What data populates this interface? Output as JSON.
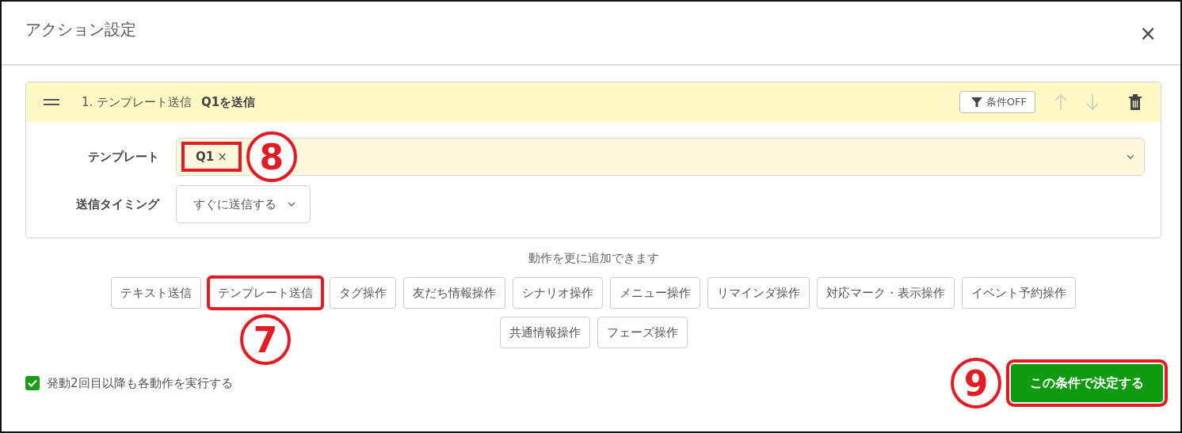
{
  "dialog": {
    "title": "アクション設定",
    "close": "×"
  },
  "action": {
    "number": "1.",
    "type": "テンプレート送信",
    "summary": "Q1を送信",
    "condition_button": "条件OFF",
    "move_up_disabled": true,
    "move_down_disabled": true,
    "fields": [
      {
        "kind": "tags",
        "label": "テンプレート",
        "tags": [
          {
            "text": "Q1",
            "remove": "×",
            "highlighted": true,
            "callout": "8"
          }
        ]
      },
      {
        "kind": "select",
        "label": "送信タイミング",
        "value": "すぐに送信する"
      }
    ]
  },
  "add_hint": "動作を更に追加できます",
  "add_buttons": [
    {
      "label": "テキスト送信",
      "highlighted": false
    },
    {
      "label": "テンプレート送信",
      "highlighted": true,
      "callout": "7"
    },
    {
      "label": "タグ操作",
      "highlighted": false
    },
    {
      "label": "友だち情報操作",
      "highlighted": false
    },
    {
      "label": "シナリオ操作",
      "highlighted": false
    },
    {
      "label": "メニュー操作",
      "highlighted": false
    },
    {
      "label": "リマインダ操作",
      "highlighted": false
    },
    {
      "label": "対応マーク・表示操作",
      "highlighted": false
    },
    {
      "label": "イベント予約操作",
      "highlighted": false
    },
    {
      "label": "共通情報操作",
      "highlighted": false
    },
    {
      "label": "フェーズ操作",
      "highlighted": false
    }
  ],
  "repeat_option": {
    "label": "発動2回目以降も各動作を実行する",
    "checked": true
  },
  "submit": {
    "label": "この条件で決定する",
    "highlighted": true,
    "callout": "9"
  }
}
